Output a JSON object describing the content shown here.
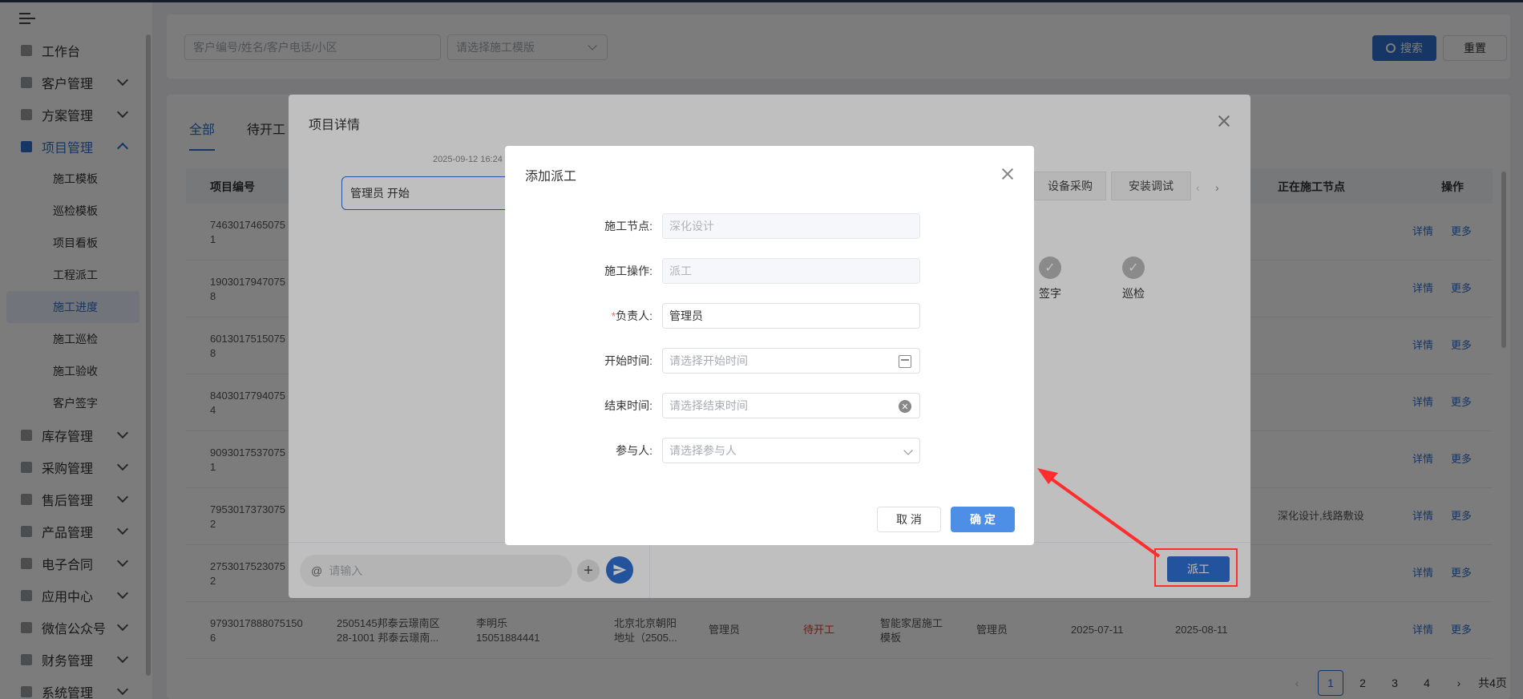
{
  "sidebar": {
    "items": [
      {
        "label": "工作台",
        "icon": "home-icon"
      },
      {
        "label": "客户管理",
        "icon": "customer-icon"
      },
      {
        "label": "方案管理",
        "icon": "plan-icon"
      },
      {
        "label": "项目管理",
        "icon": "folder-icon"
      },
      {
        "label": "库存管理",
        "icon": "inventory-icon"
      },
      {
        "label": "采购管理",
        "icon": "cart-icon"
      },
      {
        "label": "售后管理",
        "icon": "headset-icon"
      },
      {
        "label": "产品管理",
        "icon": "product-icon"
      },
      {
        "label": "电子合同",
        "icon": "contract-icon"
      },
      {
        "label": "应用中心",
        "icon": "apps-icon"
      },
      {
        "label": "微信公众号",
        "icon": "wechat-icon"
      },
      {
        "label": "财务管理",
        "icon": "finance-icon"
      },
      {
        "label": "系统管理",
        "icon": "settings-icon"
      }
    ],
    "sub_items": [
      "施工模板",
      "巡检模板",
      "项目看板",
      "工程派工",
      "施工进度",
      "施工巡检",
      "施工验收",
      "客户签字"
    ],
    "active_sub": "施工进度"
  },
  "search": {
    "keyword_placeholder": "客户编号/姓名/客户电话/小区",
    "template_placeholder": "请选择施工模版",
    "search_label": "搜索",
    "reset_label": "重置"
  },
  "tabs": [
    "全部",
    "待开工"
  ],
  "table": {
    "headers": {
      "code": "项目编号",
      "node": "正在施工节点",
      "ops": "操作"
    },
    "rows": [
      {
        "code1": "7463017465075",
        "code2": "1",
        "node": ""
      },
      {
        "code1": "1903017947075",
        "code2": "8",
        "node": ""
      },
      {
        "code1": "6013017515075",
        "code2": "8",
        "node": ""
      },
      {
        "code1": "8403017794075",
        "code2": "4",
        "node": ""
      },
      {
        "code1": "9093017537075",
        "code2": "1",
        "node": ""
      },
      {
        "code1": "7953017373075",
        "code2": "2",
        "node": "深化设计,线路敷设"
      },
      {
        "code1": "2753017523075",
        "code2": "2",
        "node": ""
      }
    ],
    "last_row": {
      "code1": "9793017888075150",
      "code2": "6",
      "addr1": "2505145邦泰云璟南区",
      "addr2": "28-1001 邦泰云璟南...",
      "name": "李明乐",
      "phone": "15051884441",
      "loc1": "北京北京朝阳",
      "loc2": "地址（2505...",
      "manager": "管理员",
      "status": "待开工",
      "template1": "智能家居施工",
      "template2": "模板",
      "leader": "管理员",
      "start": "2025-07-11",
      "end": "2025-08-11"
    },
    "op_detail": "详情",
    "op_more": "更多"
  },
  "pagination": {
    "pages": [
      "1",
      "2",
      "3",
      "4"
    ],
    "current": "1",
    "total_text": "共4页"
  },
  "detail_modal": {
    "title": "项目详情",
    "chat_timestamp": "2025-09-12 16:24",
    "chat_message": "管理员 开始",
    "chat_at": "@",
    "chat_placeholder": "请输入",
    "node_tabs": [
      "设备采购",
      "安装调试"
    ],
    "steps": [
      "签字",
      "巡检"
    ],
    "dispatch_label": "派工"
  },
  "dialog": {
    "title": "添加派工",
    "fields": {
      "node_label": "施工节点:",
      "node_value": "深化设计",
      "operation_label": "施工操作:",
      "operation_value": "派工",
      "owner_label": "负责人:",
      "owner_required": "*",
      "owner_value": "管理员",
      "start_label": "开始时间:",
      "start_placeholder": "请选择开始时间",
      "end_label": "结束时间:",
      "end_placeholder": "请选择结束时间",
      "participants_label": "参与人:",
      "participants_placeholder": "请选择参与人"
    },
    "cancel_label": "取 消",
    "confirm_label": "确 定"
  },
  "colors": {
    "primary": "#2f6fd0",
    "status_pending": "#e6382f",
    "annotation": "#ff2d2d"
  }
}
